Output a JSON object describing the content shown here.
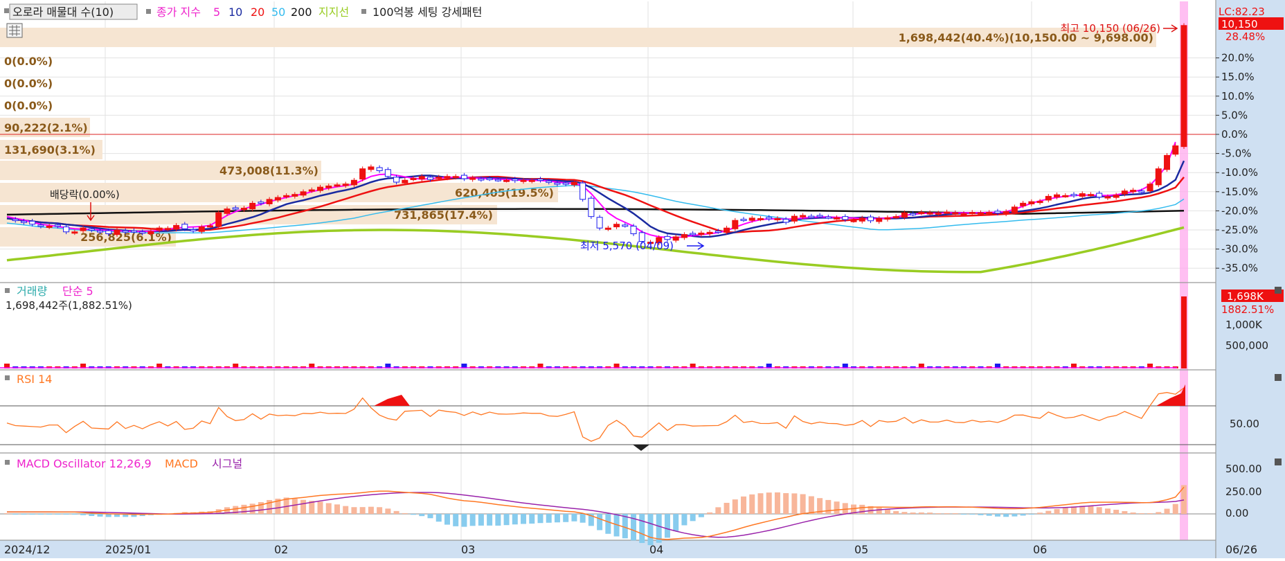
{
  "colors": {
    "up": "#ee1111",
    "down": "#1a1aee",
    "ma5": "#ff00ff",
    "ma10": "#1a2aa0",
    "ma20": "#ee1111",
    "ma50": "#33bbee",
    "ma200": "#111111",
    "support": "#99cc22",
    "rsi": "#ff7722",
    "macd_line": "#ff7722",
    "signal_line": "#9922aa",
    "osc_pos": "#f8b69a",
    "osc_neg": "#88ccee",
    "vp_bg": "#f6e5d2",
    "vp_text": "#8a5a1a",
    "today": "#ffaaee"
  },
  "main_legend": {
    "aura": "오로라 매물대 수(10)",
    "close_ma": "종가 지수",
    "p5": "5",
    "p10": "10",
    "p20": "20",
    "p50": "50",
    "p200": "200",
    "support": "지지선",
    "pattern": "100억봉 세팅 강세패턴"
  },
  "lc_label": "LC:82.23",
  "price_badge": "10,150",
  "pct_badge": "28.48%",
  "pct_ticks": [
    "20.0%",
    "15.0%",
    "10.0%",
    "5.0%",
    "0.0%",
    "-5.0%",
    "-10.0%",
    "-15.0%",
    "-20.0%",
    "-25.0%",
    "-30.0%",
    "-35.0%"
  ],
  "annotations": {
    "high": "최고 10,150 (06/26)",
    "low": "최저 5,570 (04/09)",
    "dividend": "배당락(0.00%)"
  },
  "volume_profile": [
    "1,698,442(40.4%)(10,150.00 ~ 9,698.00)",
    "0(0.0%)",
    "0(0.0%)",
    "0(0.0%)",
    "90,222(2.1%)",
    "131,690(3.1%)",
    "473,008(11.3%)",
    "620,405(19.5%)",
    "731,865(17.4%)",
    "256,825(6.1%)"
  ],
  "volume_panel": {
    "title": "거래량",
    "ma": "단순 5",
    "info": "1,698,442주(1,882.51%)",
    "badge": "1,698K",
    "badge_pct": "1882.51%",
    "ticks": [
      "1,000K",
      "500,000"
    ]
  },
  "rsi_panel": {
    "title": "RSI 14",
    "tick": "50.00"
  },
  "macd_panel": {
    "title": "MACD Oscillator 12,26,9",
    "macd": "MACD",
    "signal": "시그널",
    "ticks": [
      "500.00",
      "250.00",
      "0.00"
    ]
  },
  "x_axis": {
    "labels": [
      "2024/12",
      "2025/01",
      "02",
      "03",
      "04",
      "05",
      "06"
    ],
    "end": "06/26"
  },
  "chart_data": {
    "type": "candlestick",
    "title": "",
    "panels": [
      "price",
      "volume",
      "RSI 14",
      "MACD Oscillator 12,26,9"
    ],
    "period": "2024/12 ~ 06/26 (daily)",
    "price_range": [
      5570,
      10150
    ],
    "high": {
      "value": 10150,
      "date": "06/26"
    },
    "low": {
      "value": 5570,
      "date": "04/09"
    },
    "last_close": 10150,
    "last_volume": 1698442,
    "moving_averages": [
      5,
      10,
      20,
      50,
      200
    ],
    "percent_axis": {
      "min": -35,
      "max": 28.48,
      "unit": "%"
    },
    "months": [
      "2024/12",
      "2025/01",
      "02",
      "03",
      "04",
      "05",
      "06"
    ],
    "close_pct_series": [
      -22,
      -22.5,
      -23,
      -23.5,
      -24,
      -24,
      -24,
      -25.5,
      -25.5,
      -24.5,
      -25,
      -25.5,
      -26,
      -25,
      -25.5,
      -25.3,
      -25.8,
      -25.4,
      -24.5,
      -24.6,
      -23.8,
      -24.7,
      -25.2,
      -24.2,
      -23.9,
      -20.5,
      -19.5,
      -19.5,
      -19.3,
      -18,
      -18,
      -17,
      -16.5,
      -16,
      -15.7,
      -15,
      -14.5,
      -13.8,
      -13.5,
      -13.2,
      -13,
      -12,
      -9,
      -8.5,
      -9.5,
      -11,
      -12.5,
      -12,
      -11.5,
      -11,
      -11.8,
      -11.2,
      -11,
      -11,
      -11.6,
      -11.4,
      -11.8,
      -11.6,
      -11.8,
      -12,
      -12.1,
      -12,
      -12,
      -12,
      -12.5,
      -13,
      -13,
      -12.5,
      -17,
      -21.5,
      -24.5,
      -24.5,
      -23.5,
      -23.8,
      -26,
      -28,
      -28.2,
      -27,
      -27.5,
      -26.8,
      -26.2,
      -26,
      -25.8,
      -25.6,
      -25.4,
      -24.5,
      -22.5,
      -22.3,
      -21.9,
      -22,
      -22.1,
      -22,
      -23,
      -21.4,
      -21.2,
      -21.5,
      -21.4,
      -21.6,
      -21.8,
      -22.3,
      -22.5,
      -21.9,
      -22.6,
      -22,
      -21.8,
      -21.5,
      -20.5,
      -20.8,
      -20.4,
      -20.5,
      -20.6,
      -20.3,
      -20.5,
      -20.7,
      -20.4,
      -20.5,
      -20.4,
      -20.6,
      -20.2,
      -19,
      -18,
      -17.6,
      -17.5,
      -16.2,
      -15.8,
      -16,
      -16,
      -15.5,
      -15.7,
      -16.4,
      -16.3,
      -15.9,
      -14.8,
      -14.6,
      -15.1,
      -13,
      -9,
      -5.5,
      -3,
      28.48
    ],
    "ma5_pct_series": [
      -21.5,
      -22,
      -22.4,
      -23,
      -23.5,
      -23.8,
      -24.1,
      -24.4,
      -24.7,
      -24.8,
      -24.9,
      -25,
      -25.1,
      -25.2,
      -25.3,
      -25.4,
      -25.4,
      -25.3,
      -25.1,
      -24.8,
      -24.5,
      -24.3,
      -24.2,
      -24.1,
      -23.8,
      -22.5,
      -21.2,
      -20.2,
      -19.5,
      -18.8,
      -18.3,
      -17.6,
      -17,
      -16.5,
      -16,
      -15.6,
      -15,
      -14.5,
      -14.1,
      -13.7,
      -13.4,
      -13,
      -12,
      -11,
      -10.5,
      -10.4,
      -10.7,
      -11.1,
      -11.5,
      -11.7,
      -11.6,
      -11.4,
      -11.3,
      -11.2,
      -11.3,
      -11.4,
      -11.5,
      -11.6,
      -11.7,
      -11.8,
      -11.9,
      -12,
      -12,
      -12.1,
      -12.2,
      -12.5,
      -12.7,
      -12.8,
      -13.5,
      -15.5,
      -18,
      -20.5,
      -22,
      -23,
      -24,
      -25.5,
      -26.3,
      -26.8,
      -27,
      -27,
      -26.8,
      -26.5,
      -26.2,
      -26,
      -25.7,
      -25.2,
      -24.3,
      -23.5,
      -22.8,
      -22.3,
      -22.1,
      -22.1,
      -22.2,
      -22.1,
      -21.9,
      -21.7,
      -21.6,
      -21.6,
      -21.7,
      -21.8,
      -21.9,
      -22,
      -22.1,
      -22,
      -21.9,
      -21.6,
      -21.2,
      -20.9,
      -20.7,
      -20.6,
      -20.6,
      -20.5,
      -20.5,
      -20.5,
      -20.5,
      -20.5,
      -20.4,
      -20.4,
      -20.2,
      -19.6,
      -18.8,
      -18,
      -17.4,
      -16.9,
      -16.5,
      -16.2,
      -16,
      -15.9,
      -15.9,
      -16,
      -16,
      -15.8,
      -15.4,
      -15,
      -14.5,
      -13.3,
      -11,
      -8,
      -2
    ]
  }
}
